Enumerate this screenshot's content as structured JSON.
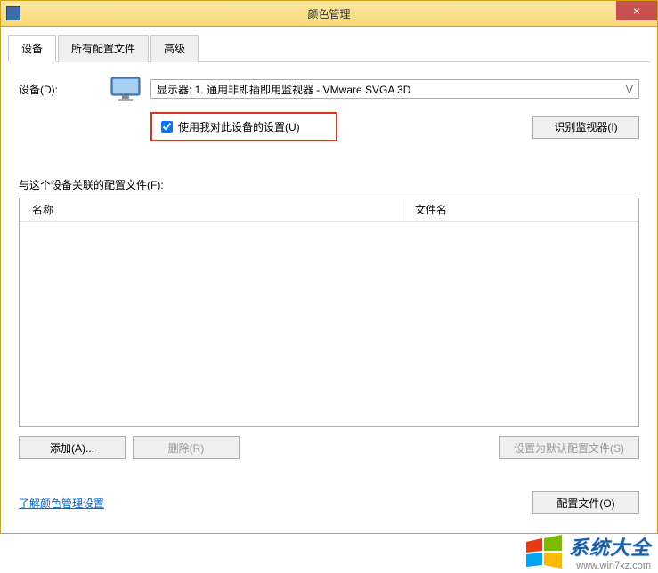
{
  "titlebar": {
    "title": "颜色管理",
    "close": "×"
  },
  "tabs": {
    "device": "设备",
    "all_profiles": "所有配置文件",
    "advanced": "高级"
  },
  "device": {
    "label": "设备(D):",
    "selected": "显示器: 1. 通用非即插即用监视器 - VMware SVGA 3D",
    "checkbox": "使用我对此设备的设置(U)",
    "identify_btn": "识别监视器(I)"
  },
  "profiles": {
    "section_label": "与这个设备关联的配置文件(F):",
    "col_name": "名称",
    "col_file": "文件名"
  },
  "buttons": {
    "add": "添加(A)...",
    "remove": "删除(R)",
    "set_default": "设置为默认配置文件(S)"
  },
  "footer": {
    "link": "了解颜色管理设置",
    "profiles_btn": "配置文件(O)"
  },
  "watermark": {
    "title": "系统大全",
    "url": "www.win7xz.com"
  }
}
